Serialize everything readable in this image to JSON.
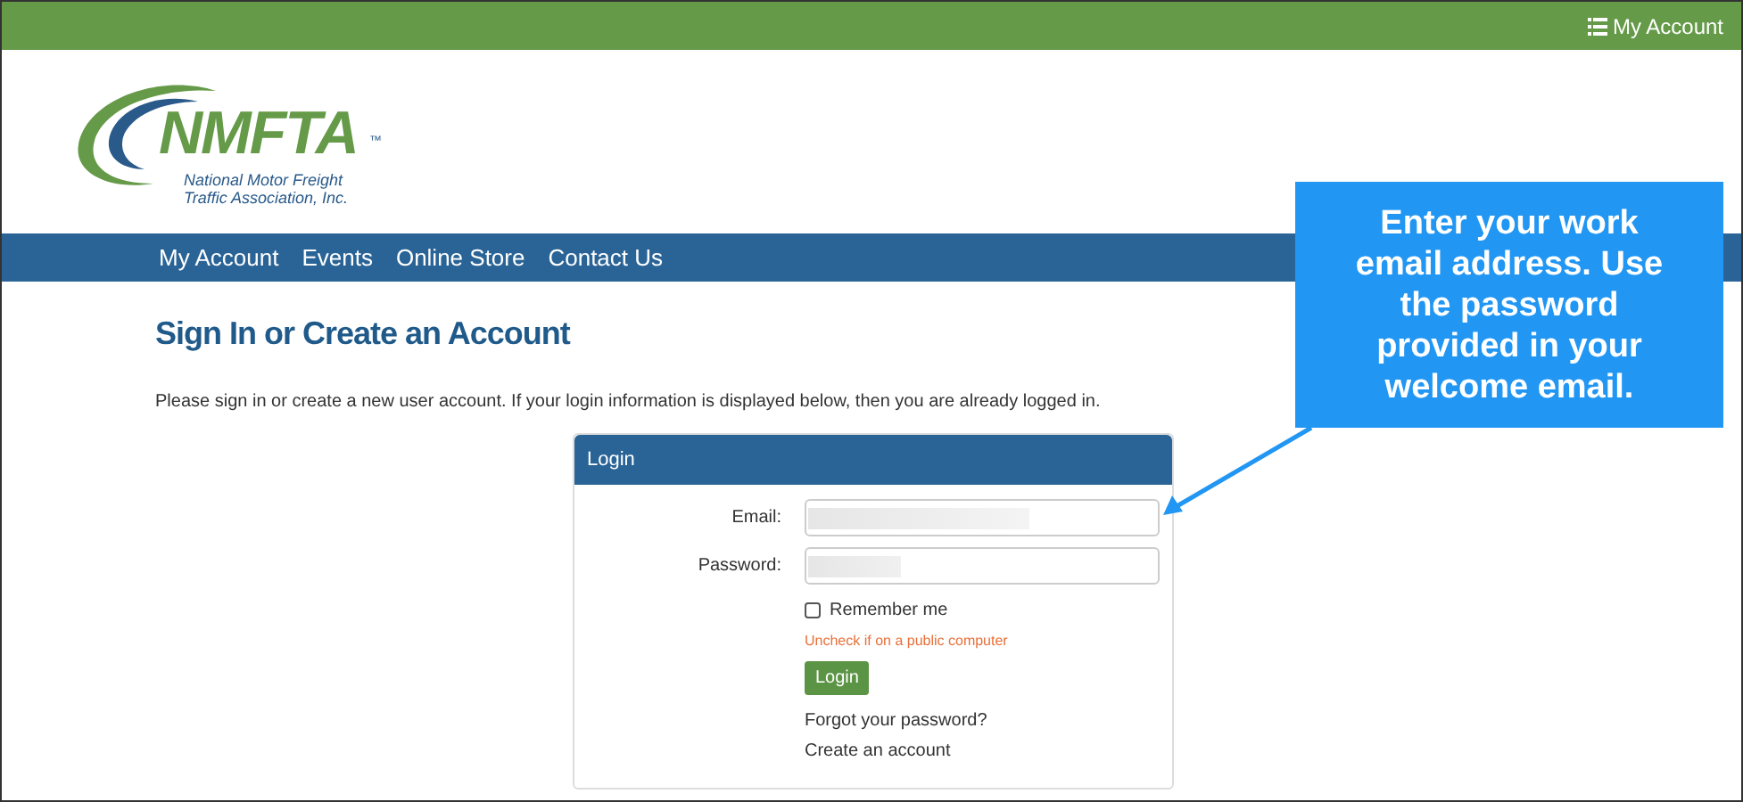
{
  "top_bar": {
    "account_link": "My Account"
  },
  "logo": {
    "wordmark": "NMFTA",
    "trademark": "™",
    "line_1": "National Motor Freight",
    "line_2": "Traffic Association, Inc."
  },
  "nav": {
    "items": [
      "My Account",
      "Events",
      "Online Store",
      "Contact Us"
    ]
  },
  "page": {
    "title": "Sign In or Create an Account",
    "intro": "Please sign in or create a new user account. If your login information is displayed below, then you are already logged in."
  },
  "login_panel": {
    "title": "Login",
    "email_label": "Email:",
    "password_label": "Password:",
    "remember": {
      "label": "Remember me",
      "checked": false
    },
    "remember_hint": "Uncheck if on a public computer",
    "login_button": "Login",
    "links": [
      "Forgot your password?",
      "Create an account"
    ]
  },
  "callout": {
    "text": "Enter your work email address. Use the password provided in your welcome email."
  }
}
